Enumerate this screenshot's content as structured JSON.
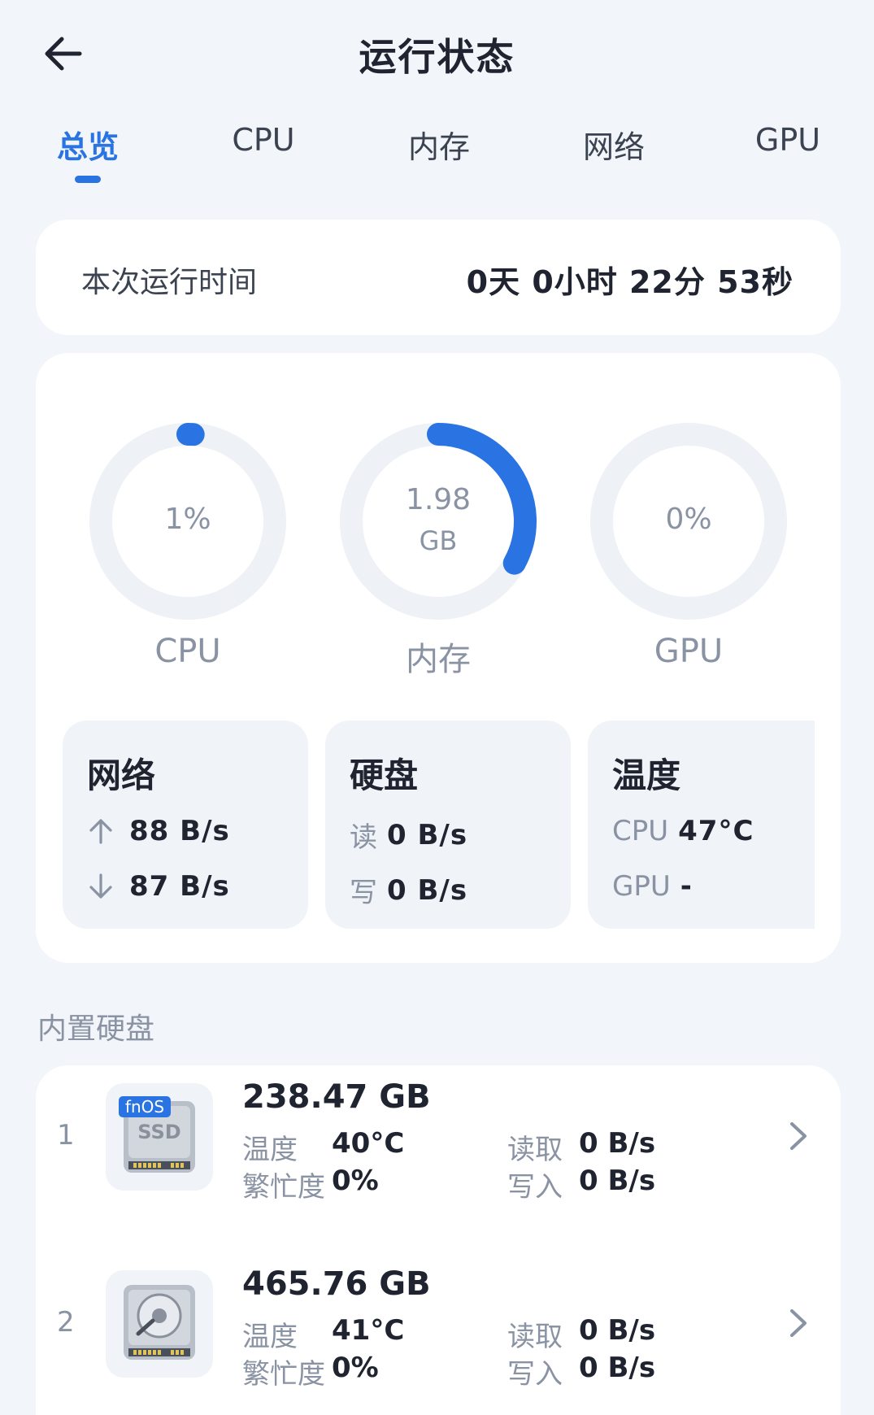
{
  "header": {
    "title": "运行状态",
    "back_icon": "arrow-left-icon"
  },
  "tabs": [
    {
      "label": "总览",
      "active": true
    },
    {
      "label": "CPU",
      "active": false
    },
    {
      "label": "内存",
      "active": false
    },
    {
      "label": "网络",
      "active": false
    },
    {
      "label": "GPU",
      "active": false
    }
  ],
  "uptime": {
    "label": "本次运行时间",
    "value": "0天 0小时 22分 53秒"
  },
  "gauges": [
    {
      "label": "CPU",
      "value_line1": "1%",
      "value_line2": "",
      "fraction": 0.01
    },
    {
      "label": "内存",
      "value_line1": "1.98",
      "value_line2": "GB",
      "fraction": 0.33
    },
    {
      "label": "GPU",
      "value_line1": "0%",
      "value_line2": "",
      "fraction": 0
    }
  ],
  "network": {
    "title": "网络",
    "up": "88 B/s",
    "down": "87 B/s",
    "up_icon": "arrow-up-icon",
    "down_icon": "arrow-down-icon"
  },
  "disk_io": {
    "title": "硬盘",
    "read_label": "读",
    "read": "0 B/s",
    "write_label": "写",
    "write": "0 B/s"
  },
  "temperature": {
    "title": "温度",
    "cpu_label": "CPU",
    "cpu": "47°C",
    "gpu_label": "GPU",
    "gpu": "-"
  },
  "disks_section": {
    "title": "内置硬盘"
  },
  "disks": [
    {
      "index": "1",
      "size": "238.47 GB",
      "temp_label": "温度",
      "temp": "40°C",
      "busy_label": "繁忙度",
      "busy": "0%",
      "read_label": "读取",
      "read": "0 B/s",
      "write_label": "写入",
      "write": "0 B/s",
      "badge": "fnOS",
      "icon_text": "SSD",
      "icon": "ssd-icon"
    },
    {
      "index": "2",
      "size": "465.76 GB",
      "temp_label": "温度",
      "temp": "41°C",
      "busy_label": "繁忙度",
      "busy": "0%",
      "read_label": "读取",
      "read": "0 B/s",
      "write_label": "写入",
      "write": "0 B/s",
      "icon": "hdd-icon"
    }
  ],
  "colors": {
    "accent": "#2a73e2",
    "track": "#eef1f5",
    "muted": "#8a93a3"
  }
}
